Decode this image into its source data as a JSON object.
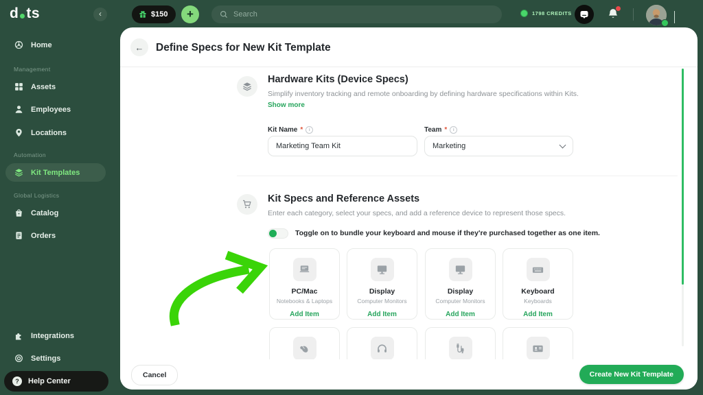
{
  "icons": {
    "back_arrow": "←",
    "plus": "+"
  },
  "colors": {
    "accent_green": "#27a55d",
    "button_green": "#22ab57",
    "arrow_green": "#3ad408",
    "sidebar_bg": "#2c4e3e",
    "active_item_text": "#7fe880",
    "alert_red": "#e8484a"
  },
  "brand": {
    "logo_left": "d",
    "logo_right": "ts"
  },
  "topbar": {
    "balance": "$150",
    "search_placeholder": "Search",
    "credits": "1798 CREDITS"
  },
  "sidebar": {
    "sections": [
      {
        "label": "",
        "items": [
          {
            "label": "Home",
            "icon": "home-icon"
          }
        ]
      },
      {
        "label": "Management",
        "items": [
          {
            "label": "Assets",
            "icon": "grid-icon"
          },
          {
            "label": "Employees",
            "icon": "person-icon"
          },
          {
            "label": "Locations",
            "icon": "pin-icon"
          }
        ]
      },
      {
        "label": "Automation",
        "items": [
          {
            "label": "Kit Templates",
            "icon": "layers-icon",
            "active": true
          }
        ]
      },
      {
        "label": "Global Logistics",
        "items": [
          {
            "label": "Catalog",
            "icon": "bag-icon"
          },
          {
            "label": "Orders",
            "icon": "receipt-icon"
          }
        ]
      }
    ],
    "footer_items": [
      {
        "label": "Integrations",
        "icon": "puzzle-icon"
      },
      {
        "label": "Settings",
        "icon": "gear-icon"
      },
      {
        "label": "Help Center",
        "icon": "question-icon"
      }
    ]
  },
  "page": {
    "title": "Define Specs for New Kit Template",
    "section1": {
      "title": "Hardware Kits (Device Specs)",
      "description": "Simplify inventory tracking and remote onboarding by defining hardware specifications within Kits.",
      "link": "Show more"
    },
    "form": {
      "required_mark": "*",
      "kit_name_label": "Kit Name",
      "kit_name_value": "Marketing Team Kit",
      "team_label": "Team",
      "team_value": "Marketing"
    },
    "section2": {
      "title": "Kit Specs and Reference Assets",
      "description": "Enter each category, select your specs, and add a reference device to represent those specs.",
      "toggle_text": "Toggle on to bundle your keyboard and mouse if they're purchased together as one item."
    },
    "categories": [
      {
        "name": "PC/Mac",
        "subtitle": "Notebooks & Laptops",
        "action": "Add Item",
        "icon": "laptop-icon"
      },
      {
        "name": "Display",
        "subtitle": "Computer Monitors",
        "action": "Add Item",
        "icon": "monitor-icon"
      },
      {
        "name": "Display",
        "subtitle": "Computer Monitors",
        "action": "Add Item",
        "icon": "monitor-icon"
      },
      {
        "name": "Keyboard",
        "subtitle": "Keyboards",
        "action": "Add Item",
        "icon": "keyboard-icon"
      }
    ],
    "categories_row2_icons": [
      "mouse-icon",
      "headphones-icon",
      "cables-icon",
      "badge-icon"
    ],
    "footer": {
      "cancel": "Cancel",
      "submit": "Create New Kit Template"
    }
  }
}
